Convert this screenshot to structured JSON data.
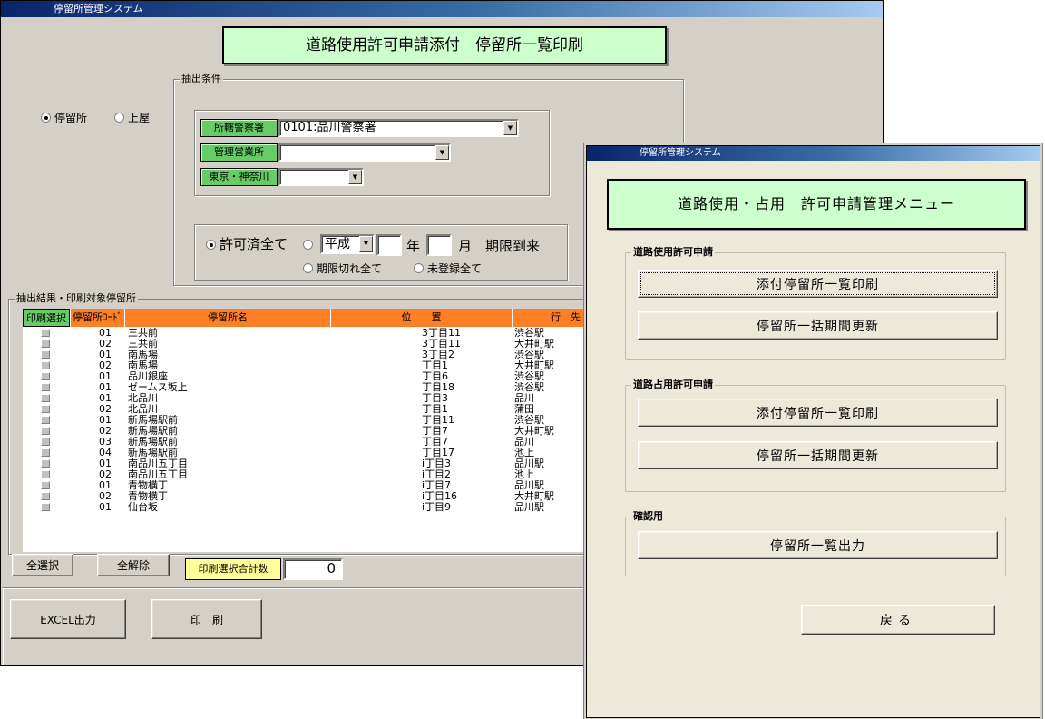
{
  "window1": {
    "title": "停留所管理システム",
    "banner": "道路使用許可申請添付　停留所一覧印刷",
    "radio_stop": "停留所",
    "radio_roof": "上屋",
    "extract_group": "抽出条件",
    "police_label": "所轄警察署",
    "police_value": "0101:品川警察署",
    "office_label": "管理営業所",
    "office_value": "",
    "region_label": "東京・神奈川",
    "region_value": "",
    "permit_all": "許可済全て",
    "era_value": "平成",
    "year_label": "年",
    "month_label": "月",
    "due_label": "期限到来",
    "expired_all": "期限切れ全て",
    "unregistered_all": "未登録全て",
    "result_group": "抽出結果・印刷対象停留所",
    "columns": [
      "印刷選択",
      "停留所ｺｰﾄﾞ",
      "停留所名",
      "位　　置",
      "行　先"
    ],
    "rows": [
      {
        "code": "01",
        "name": "三共前",
        "pos": "3丁目11",
        "dest": "渋谷駅"
      },
      {
        "code": "02",
        "name": "三共前",
        "pos": "3丁目11",
        "dest": "大井町駅"
      },
      {
        "code": "01",
        "name": "南馬場",
        "pos": "3丁目2",
        "dest": "渋谷駅"
      },
      {
        "code": "02",
        "name": "南馬場",
        "pos": "丁目1",
        "dest": "大井町駅"
      },
      {
        "code": "01",
        "name": "品川銀座",
        "pos": "丁目6",
        "dest": "渋谷駅"
      },
      {
        "code": "01",
        "name": "ゼームス坂上",
        "pos": "丁目18",
        "dest": "渋谷駅"
      },
      {
        "code": "01",
        "name": "北品川",
        "pos": "丁目3",
        "dest": "品川"
      },
      {
        "code": "02",
        "name": "北品川",
        "pos": "丁目1",
        "dest": "蒲田"
      },
      {
        "code": "01",
        "name": "新馬場駅前",
        "pos": "丁目11",
        "dest": "渋谷駅"
      },
      {
        "code": "02",
        "name": "新馬場駅前",
        "pos": "丁目7",
        "dest": "大井町駅"
      },
      {
        "code": "03",
        "name": "新馬場駅前",
        "pos": "丁目7",
        "dest": "品川"
      },
      {
        "code": "04",
        "name": "新馬場駅前",
        "pos": "丁目17",
        "dest": "池上"
      },
      {
        "code": "01",
        "name": "南品川五丁目",
        "pos": "i丁目3",
        "dest": "品川駅"
      },
      {
        "code": "02",
        "name": "南品川五丁目",
        "pos": "i丁目2",
        "dest": "池上"
      },
      {
        "code": "01",
        "name": "青物横丁",
        "pos": "i丁目7",
        "dest": "品川駅"
      },
      {
        "code": "02",
        "name": "青物横丁",
        "pos": "i丁目16",
        "dest": "大井町駅"
      },
      {
        "code": "01",
        "name": "仙台坂",
        "pos": "i丁目9",
        "dest": "品川駅"
      }
    ],
    "select_all": "全選択",
    "deselect_all": "全解除",
    "total_label": "印刷選択合計数",
    "total_value": "0",
    "excel_button": "EXCEL出力",
    "print_button": "印　刷"
  },
  "window2": {
    "title": "停留所管理システム",
    "banner": "道路使用・占用　許可申請管理メニュー",
    "group1": "道路使用許可申請",
    "g1_btn1": "添付停留所一覧印刷",
    "g1_btn2": "停留所一括期間更新",
    "group2": "道路占用許可申請",
    "g2_btn1": "添付停留所一覧印刷",
    "g2_btn2": "停留所一括期間更新",
    "group3": "確認用",
    "g3_btn1": "停留所一覧出力",
    "back_button": "戻る"
  },
  "colors": {
    "banner_green": "#ccffcc",
    "label_green": "#66cc66",
    "header_orange": "#ff7f27",
    "total_yellow": "#ffff99",
    "title_blue": "#0a246a"
  }
}
